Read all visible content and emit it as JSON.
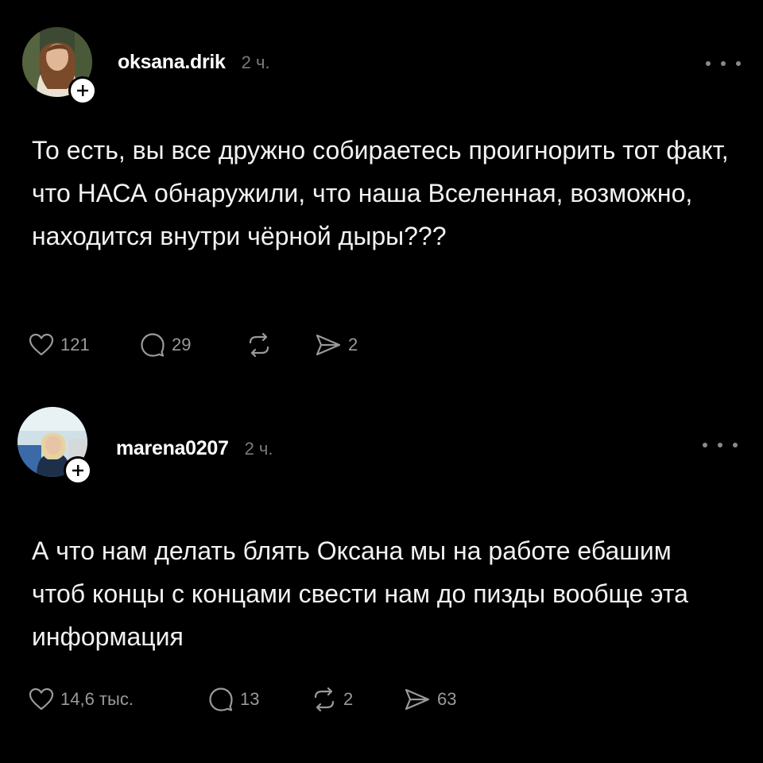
{
  "posts": [
    {
      "username": "oksana.drik",
      "time": "2 ч.",
      "text": "То есть, вы все дружно собираетесь проигнорить тот факт, что НАСА обнаружили, что наша Вселенная, возможно, находится внутри чёрной дыры???",
      "likes": "121",
      "replies": "29",
      "reposts": "",
      "shares": "2"
    },
    {
      "username": "marena0207",
      "time": "2 ч.",
      "text": "А что нам делать блять  Оксана мы на работе ебашим чтоб концы с концами свести нам до пизды вообще эта информация",
      "likes": "14,6 тыс.",
      "replies": "13",
      "reposts": "2",
      "shares": "63"
    }
  ],
  "icons": {
    "like": "heart-icon",
    "reply": "comment-icon",
    "repost": "repost-icon",
    "share": "send-icon",
    "more": "more-horizontal-icon",
    "follow": "plus-icon"
  },
  "colors": {
    "background": "#000000",
    "text": "#f2f2f2",
    "muted": "#8a8a8a"
  }
}
